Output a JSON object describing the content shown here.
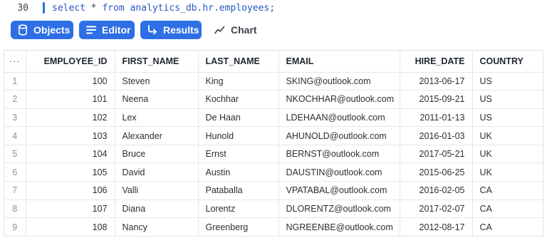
{
  "editor": {
    "line_number": "30",
    "sql_before": "select ",
    "sql_star": "*",
    "sql_after": " from analytics_db.hr.employees;"
  },
  "toolbar": {
    "objects_label": "Objects",
    "editor_label": "Editor",
    "results_label": "Results",
    "chart_label": "Chart",
    "colors": {
      "accent": "#2f6fe6",
      "cursor": "#2a6ee8"
    }
  },
  "grid": {
    "menu_label": "···",
    "columns": [
      "EMPLOYEE_ID",
      "FIRST_NAME",
      "LAST_NAME",
      "EMAIL",
      "HIRE_DATE",
      "COUNTRY"
    ],
    "rows": [
      [
        "1",
        "100",
        "Steven",
        "King",
        "SKING@outlook.com",
        "2013-06-17",
        "US"
      ],
      [
        "2",
        "101",
        "Neena",
        "Kochhar",
        "NKOCHHAR@outlook.com",
        "2015-09-21",
        "US"
      ],
      [
        "3",
        "102",
        "Lex",
        "De Haan",
        "LDEHAAN@outlook.com",
        "2011-01-13",
        "US"
      ],
      [
        "4",
        "103",
        "Alexander",
        "Hunold",
        "AHUNOLD@outlook.com",
        "2016-01-03",
        "UK"
      ],
      [
        "5",
        "104",
        "Bruce",
        "Ernst",
        "BERNST@outlook.com",
        "2017-05-21",
        "UK"
      ],
      [
        "6",
        "105",
        "David",
        "Austin",
        "DAUSTIN@outlook.com",
        "2015-06-25",
        "UK"
      ],
      [
        "7",
        "106",
        "Valli",
        "Pataballa",
        "VPATABAL@outlook.com",
        "2016-02-05",
        "CA"
      ],
      [
        "8",
        "107",
        "Diana",
        "Lorentz",
        "DLORENTZ@outlook.com",
        "2017-02-07",
        "CA"
      ],
      [
        "9",
        "108",
        "Nancy",
        "Greenberg",
        "NGREENBE@outlook.com",
        "2012-08-17",
        "CA"
      ]
    ]
  },
  "icons": {
    "objects": "database-icon",
    "editor": "list-lines-icon",
    "results": "arrow-turn-icon",
    "chart": "line-chart-icon"
  }
}
